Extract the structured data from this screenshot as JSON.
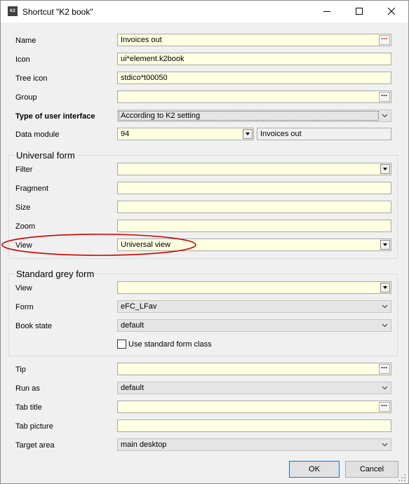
{
  "window": {
    "title": "Shortcut \"K2 book\"",
    "app_icon": "K2"
  },
  "fields": {
    "name": {
      "label": "Name",
      "value": "Invoices out"
    },
    "icon": {
      "label": "Icon",
      "value": "ui*element.k2book"
    },
    "tree_icon": {
      "label": "Tree icon",
      "value": "stdico*t00050"
    },
    "group": {
      "label": "Group",
      "value": ""
    },
    "ui_type": {
      "label": "Type of user interface",
      "value": "According to K2 setting"
    },
    "data_module": {
      "label": "Data module",
      "value": "94",
      "description": "Invoices out"
    }
  },
  "universal_form": {
    "title": "Universal form",
    "filter": {
      "label": "Filter",
      "value": ""
    },
    "fragment": {
      "label": "Fragment",
      "value": ""
    },
    "size": {
      "label": "Size",
      "value": ""
    },
    "zoom": {
      "label": "Zoom",
      "value": ""
    },
    "view": {
      "label": "View",
      "value": "Universal view"
    }
  },
  "standard_form": {
    "title": "Standard grey form",
    "view": {
      "label": "View",
      "value": ""
    },
    "form": {
      "label": "Form",
      "value": "eFC_LFav"
    },
    "book_state": {
      "label": "Book state",
      "value": "default"
    },
    "use_std_class": {
      "label": "Use standard form class",
      "checked": false
    }
  },
  "misc": {
    "tip": {
      "label": "Tip",
      "value": ""
    },
    "run_as": {
      "label": "Run as",
      "value": "default"
    },
    "tab_title": {
      "label": "Tab title",
      "value": ""
    },
    "tab_picture": {
      "label": "Tab picture",
      "value": ""
    },
    "target_area": {
      "label": "Target area",
      "value": "main desktop"
    }
  },
  "buttons": {
    "ok": "OK",
    "cancel": "Cancel",
    "ellipsis": "..."
  },
  "colors": {
    "field_bg": "#ffffe1",
    "highlight_oval": "#cc0000",
    "ok_border": "#0078d7"
  }
}
